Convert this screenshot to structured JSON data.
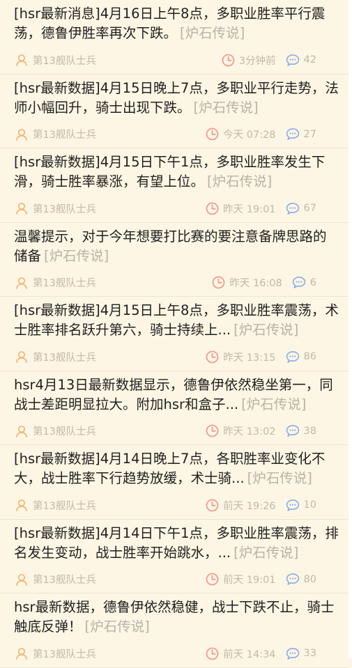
{
  "colors": {
    "background": "#fdf6e4",
    "title": "#1f1f1f",
    "source": "#b7b3aa",
    "meta": "#c2b9a5",
    "author_icon": "#f2b87a",
    "clock_icon": "#f09c93",
    "comment_icon": "#8fb0e8",
    "divider": "#ece4cf"
  },
  "icons": {
    "author": "user-icon",
    "time": "clock-icon",
    "comments": "comment-bubble-icon"
  },
  "feed": [
    {
      "title": "[hsr最新消息]4月16日上午8点，多职业胜率平行震荡，德鲁伊胜率再次下跌。",
      "source": "[炉石传说]",
      "author": "第13舰队士兵",
      "time": "3分钟前",
      "comments": "42"
    },
    {
      "title": "[hsr最新数据]4月15日晚上7点，多职业平行走势，法师小幅回升，骑士出现下跌。",
      "source": "[炉石传说]",
      "author": "第13舰队士兵",
      "time": "今天 07:28",
      "comments": "27"
    },
    {
      "title": "[hsr最新数据]4月15日下午1点，多职业胜率发生下滑，骑士胜率暴涨，有望上位。",
      "source": "[炉石传说]",
      "author": "第13舰队士兵",
      "time": "昨天 19:01",
      "comments": "67"
    },
    {
      "title": "温馨提示，对于今年想要打比赛的要注意备牌思路的储备",
      "source": "[炉石传说]",
      "author": "第13舰队士兵",
      "time": "昨天 16:08",
      "comments": "6"
    },
    {
      "title": "[hsr最新数据]4月15日上午8点，多职业胜率震荡，术士胜率排名跃升第六，骑士持续上...",
      "source": "[炉石传说]",
      "author": "第13舰队士兵",
      "time": "昨天 13:15",
      "comments": "86"
    },
    {
      "title": "hsr4月13日最新数据显示，德鲁伊依然稳坐第一，同战士差距明显拉大。附加hsr和盒子...",
      "source": "[炉石传说]",
      "author": "第13舰队士兵",
      "time": "昨天 13:02",
      "comments": "38"
    },
    {
      "title": "[hsr最新数据]4月14日晚上7点，各职胜率业变化不大，战士胜率下行趋势放缓，术士骑...",
      "source": "[炉石传说]",
      "author": "第13舰队士兵",
      "time": "前天 19:26",
      "comments": "10"
    },
    {
      "title": "[hsr最新数据]4月14日下午1点，多职业胜率震荡，排名发生变动，战士胜率开始跳水，...",
      "source": "[炉石传说]",
      "author": "第13舰队士兵",
      "time": "前天 19:01",
      "comments": "80"
    },
    {
      "title": "hsr最新数据，德鲁伊依然稳健，战士下跌不止，骑士触底反弹！",
      "source": "[炉石传说]",
      "author": "第13舰队士兵",
      "time": "前天 14:34",
      "comments": "33"
    }
  ]
}
